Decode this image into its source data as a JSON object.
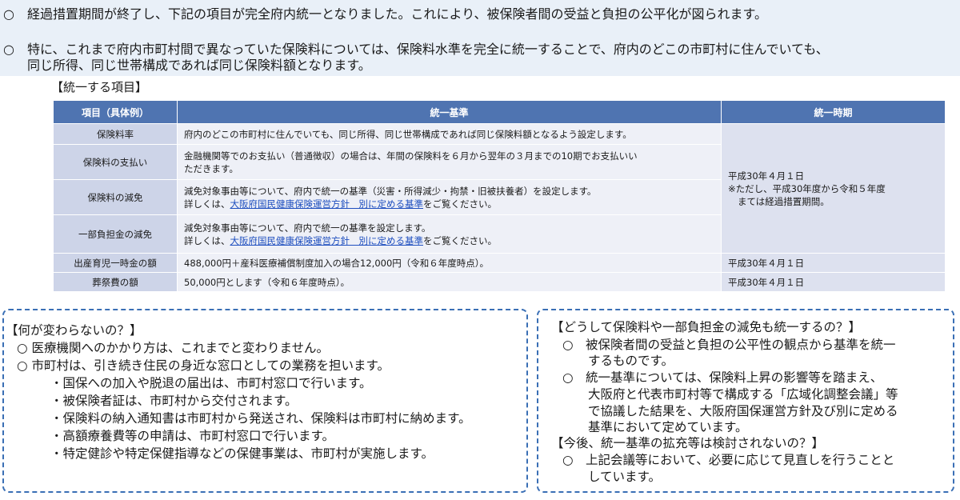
{
  "intro": {
    "bullet1": {
      "mark": "○",
      "text": "経過措置期間が終了し、下記の項目が完全府内統一となりました。これにより、被保険者間の受益と負担の公平化が図られます。"
    },
    "bullet2": {
      "mark": "○",
      "line1": "特に、これまで府内市町村間で異なっていた保険料については、保険料水準を完全に統一することで、府内のどこの市町村に住んでいても、",
      "line2": "同じ所得、同じ世帯構成であれば同じ保険料額となります。"
    }
  },
  "section_title": "【統一する項目】",
  "table": {
    "headers": [
      "項目（具体例）",
      "統一基準",
      "統一時期"
    ],
    "merged_time": {
      "line1": "平成30年４月１日",
      "line2": "※ただし、平成30年度から令和５年度",
      "line3": "まては経過措置期間。"
    },
    "rows": [
      {
        "item": "保険料率",
        "std_line1": "府内のどこの市町村に住んでいても、同じ所得、同じ世帯構成であれば同じ保険料額となるよう設定します。"
      },
      {
        "item": "保険料の支払い",
        "std_line1": "金融機関等でのお支払い（普通徴収）の場合は、年間の保険料を６月から翌年の３月までの10期でお支払いい",
        "std_line2": "ただきます。"
      },
      {
        "item": "保険料の減免",
        "std_line1": "減免対象事由等について、府内で統一の基準（災害・所得減少・拘禁・旧被扶養者）を設定します。",
        "pre": "詳しくは、",
        "link": "大阪府国民健康保険運営方針　別に定める基準",
        "post": "をご覧ください。"
      },
      {
        "item": "一部負担金の減免",
        "std_line1": "減免対象事由等について、府内で統一の基準を設定します。",
        "pre": "詳しくは、",
        "link": "大阪府国民健康保険運営方針　別に定める基準",
        "post": "をご覧ください。"
      },
      {
        "item": "出産育児一時金の額",
        "std_line1": "488,000円＋産科医療補償制度加入の場合12,000円（令和６年度時点）。",
        "time": "平成30年４月１日"
      },
      {
        "item": "葬祭費の額",
        "std_line1": "50,000円とします（令和６年度時点）。",
        "time": "平成30年４月１日"
      }
    ]
  },
  "left_box": {
    "title": "【何が変わらないの？】",
    "lines": [
      "○ 医療機関へのかかり方は、これまでと変わりません。",
      "○ 市町村は、引き続き住民の身近な窓口としての業務を担います。",
      "・国保への加入や脱退の届出は、市町村窓口で行います。",
      "・被保険者証は、市町村から交付されます。",
      "・保険料の納入通知書は市町村から発送され、保険料は市町村に納めます。",
      "・高額療養費等の申請は、市町村窓口で行います。",
      "・特定健診や特定保健指導などの保健事業は、市町村が実施します。"
    ]
  },
  "right_box": {
    "title1": "【どうして保険料や一部負担金の減免も統一するの？】",
    "q1_lines": [
      "○　被保険者間の受益と負担の公平性の観点から基準を統一",
      "するものです。",
      "○　統一基準については、保険料上昇の影響等を踏まえ、",
      "大阪府と代表市町村等で構成する「広域化調整会議」等",
      "で協議した結果を、大阪府国保運営方針及び別に定める",
      "基準において定めています。"
    ],
    "title2": "【今後、統一基準の拡充等は検討されないの？】",
    "q2_lines": [
      "○　上記会議等において、必要に応じて見直しを行うことと",
      "しています。"
    ]
  }
}
